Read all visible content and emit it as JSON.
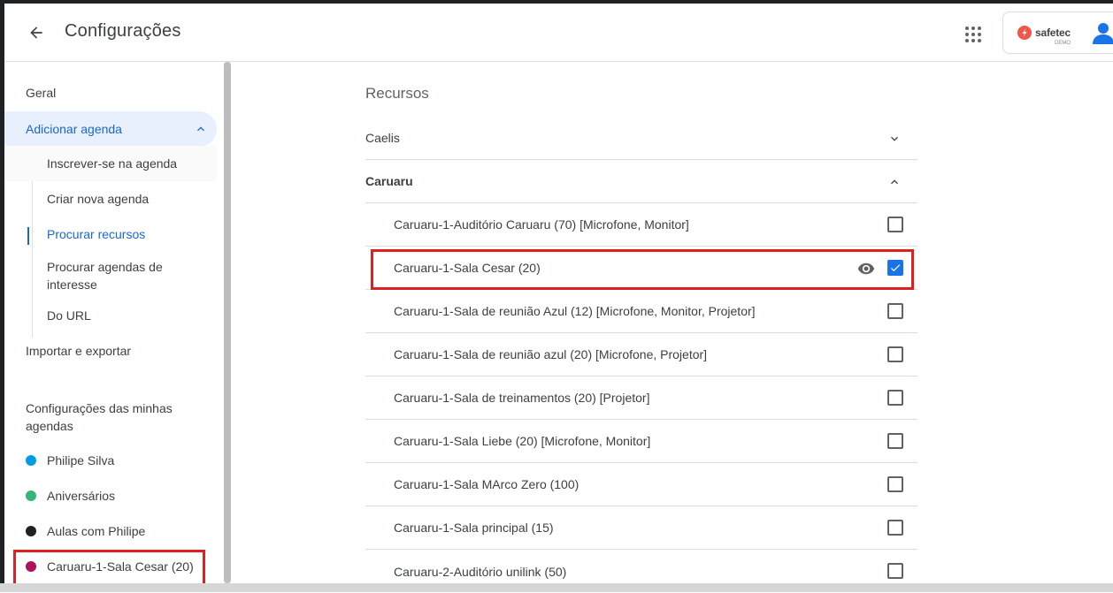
{
  "header": {
    "title": "Configurações",
    "brand_name": "safetec",
    "brand_sub": "DEMO"
  },
  "sidebar": {
    "items": [
      {
        "label": "Geral"
      },
      {
        "label": "Adicionar agenda"
      },
      {
        "label": "Inscrever-se na agenda"
      },
      {
        "label": "Criar nova agenda"
      },
      {
        "label": "Procurar recursos"
      },
      {
        "label": "Procurar agendas de interesse"
      },
      {
        "label": "Do URL"
      },
      {
        "label": "Importar e exportar"
      }
    ],
    "section_title": "Configurações das minhas agendas",
    "calendars": [
      {
        "label": "Philipe Silva",
        "color": "#039be5"
      },
      {
        "label": "Aniversários",
        "color": "#33b679"
      },
      {
        "label": "Aulas com Philipe",
        "color": "#202124"
      },
      {
        "label": "Caruaru-1-Sala Cesar (20)",
        "color": "#ad1457"
      }
    ]
  },
  "main": {
    "title": "Recursos",
    "groups": [
      {
        "label": "Caelis",
        "expanded": false
      },
      {
        "label": "Caruaru",
        "expanded": true
      }
    ],
    "resources": [
      {
        "label": "Caruaru-1-Auditório Caruaru (70) [Microfone, Monitor]",
        "checked": false
      },
      {
        "label": "Caruaru-1-Sala Cesar (20)",
        "checked": true
      },
      {
        "label": "Caruaru-1-Sala de reunião Azul (12) [Microfone, Monitor, Projetor]",
        "checked": false
      },
      {
        "label": "Caruaru-1-Sala de reunião azul (20) [Microfone, Projetor]",
        "checked": false
      },
      {
        "label": "Caruaru-1-Sala de treinamentos (20) [Projetor]",
        "checked": false
      },
      {
        "label": "Caruaru-1-Sala Liebe (20) [Microfone, Monitor]",
        "checked": false
      },
      {
        "label": "Caruaru-1-Sala MArco Zero (100)",
        "checked": false
      },
      {
        "label": "Caruaru-1-Sala principal (15)",
        "checked": false
      },
      {
        "label": "Caruaru-2-Auditório unilink (50)",
        "checked": false
      }
    ]
  },
  "colors": {
    "accent": "#1a73e8",
    "active_text": "#1967d2",
    "highlight": "#e02020",
    "brand": "#f0564a"
  }
}
